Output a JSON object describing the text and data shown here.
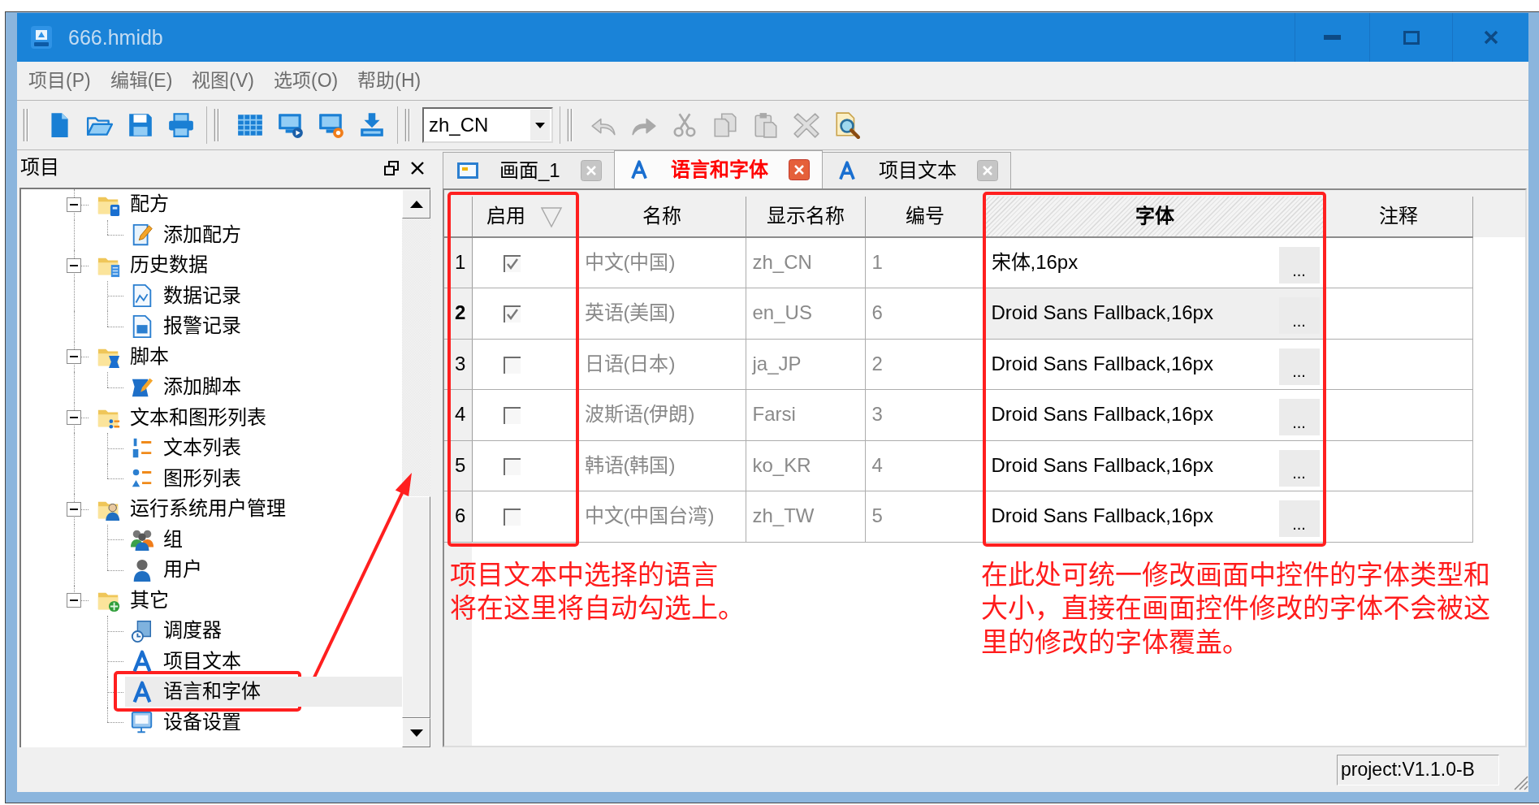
{
  "window": {
    "title": "666.hmidb"
  },
  "menu": [
    "项目(P)",
    "编辑(E)",
    "视图(V)",
    "选项(O)",
    "帮助(H)"
  ],
  "toolbar": {
    "file_tools": [
      {
        "disabled": false
      },
      {
        "disabled": false
      },
      {
        "disabled": false
      },
      {
        "disabled": false
      }
    ],
    "run_tools": [
      {
        "disabled": false
      },
      {
        "disabled": false
      },
      {
        "disabled": false
      },
      {
        "disabled": false
      }
    ],
    "language": "zh_CN",
    "edit_tools": [
      {
        "disabled": true
      },
      {
        "disabled": true
      },
      {
        "disabled": true
      },
      {
        "disabled": true
      },
      {
        "disabled": true
      },
      {
        "disabled": true
      },
      {
        "disabled": false
      }
    ]
  },
  "project_panel": {
    "title": "项目",
    "tree": [
      {
        "label": "配方",
        "expanded": true,
        "selected": false,
        "framed": false,
        "children": [
          {
            "label": "添加配方",
            "selected": false,
            "framed": false
          }
        ]
      },
      {
        "label": "历史数据",
        "expanded": true,
        "selected": false,
        "framed": false,
        "children": [
          {
            "label": "数据记录",
            "selected": false,
            "framed": false
          },
          {
            "label": "报警记录",
            "selected": false,
            "framed": false
          }
        ]
      },
      {
        "label": "脚本",
        "expanded": true,
        "selected": false,
        "framed": false,
        "children": [
          {
            "label": "添加脚本",
            "selected": false,
            "framed": false
          }
        ]
      },
      {
        "label": "文本和图形列表",
        "expanded": true,
        "selected": false,
        "framed": false,
        "children": [
          {
            "label": "文本列表",
            "selected": false,
            "framed": false
          },
          {
            "label": "图形列表",
            "selected": false,
            "framed": false
          }
        ]
      },
      {
        "label": "运行系统用户管理",
        "expanded": true,
        "selected": false,
        "framed": false,
        "children": [
          {
            "label": "组",
            "selected": false,
            "framed": false
          },
          {
            "label": "用户",
            "selected": false,
            "framed": false
          }
        ]
      },
      {
        "label": "其它",
        "expanded": true,
        "selected": false,
        "framed": false,
        "children": [
          {
            "label": "调度器",
            "selected": false,
            "framed": false
          },
          {
            "label": "项目文本",
            "selected": false,
            "framed": false
          },
          {
            "label": "语言和字体",
            "selected": true,
            "framed": true
          },
          {
            "label": "设备设置",
            "selected": false,
            "framed": false
          }
        ]
      }
    ]
  },
  "tabs": [
    {
      "label": "画面_1",
      "kind": "screen",
      "selected": false
    },
    {
      "label": "语言和字体",
      "kind": "font",
      "selected": true
    },
    {
      "label": "项目文本",
      "kind": "font",
      "selected": false
    }
  ],
  "table": {
    "columns": [
      {
        "label": "启用",
        "kind": "checkbox",
        "sorted": true,
        "selected": false,
        "framed": true
      },
      {
        "label": "名称",
        "kind": "name",
        "sorted": false,
        "selected": false,
        "framed": false
      },
      {
        "label": "显示名称",
        "kind": "display_name",
        "sorted": false,
        "selected": false,
        "framed": false
      },
      {
        "label": "编号",
        "kind": "code",
        "sorted": false,
        "selected": false,
        "framed": false
      },
      {
        "label": "字体",
        "kind": "font",
        "sorted": false,
        "selected": true,
        "framed": true
      },
      {
        "label": "注释",
        "kind": "comment",
        "sorted": false,
        "selected": false,
        "framed": false
      }
    ],
    "rows": [
      {
        "row_number": "1",
        "selected": false,
        "checked": true,
        "name": "中文(中国)",
        "display_name": "zh_CN",
        "code": "1",
        "font": "宋体,16px",
        "font_button": "..."
      },
      {
        "row_number": "2",
        "selected": true,
        "checked": true,
        "name": "英语(美国)",
        "display_name": "en_US",
        "code": "6",
        "font": "Droid Sans Fallback,16px",
        "font_button": "..."
      },
      {
        "row_number": "3",
        "selected": false,
        "checked": false,
        "name": "日语(日本)",
        "display_name": "ja_JP",
        "code": "2",
        "font": "Droid Sans Fallback,16px",
        "font_button": "..."
      },
      {
        "row_number": "4",
        "selected": false,
        "checked": false,
        "name": "波斯语(伊朗)",
        "display_name": "Farsi",
        "code": "3",
        "font": "Droid Sans Fallback,16px",
        "font_button": "..."
      },
      {
        "row_number": "5",
        "selected": false,
        "checked": false,
        "name": "韩语(韩国)",
        "display_name": "ko_KR",
        "code": "4",
        "font": "Droid Sans Fallback,16px",
        "font_button": "..."
      },
      {
        "row_number": "6",
        "selected": false,
        "checked": false,
        "name": "中文(中国台湾)",
        "display_name": "zh_TW",
        "code": "5",
        "font": "Droid Sans Fallback,16px",
        "font_button": "..."
      }
    ]
  },
  "notes": [
    {
      "lines": [
        "项目文本中选择的语言",
        "将在这里将自动勾选上。"
      ]
    },
    {
      "lines": [
        "在此处可统一修改画面中控件的字体类型和大小，直接在画面控件修改的字体不会被这里的修改的字体覆盖。"
      ]
    }
  ],
  "status_bar": {
    "text": "project:V1.1.0-B"
  }
}
